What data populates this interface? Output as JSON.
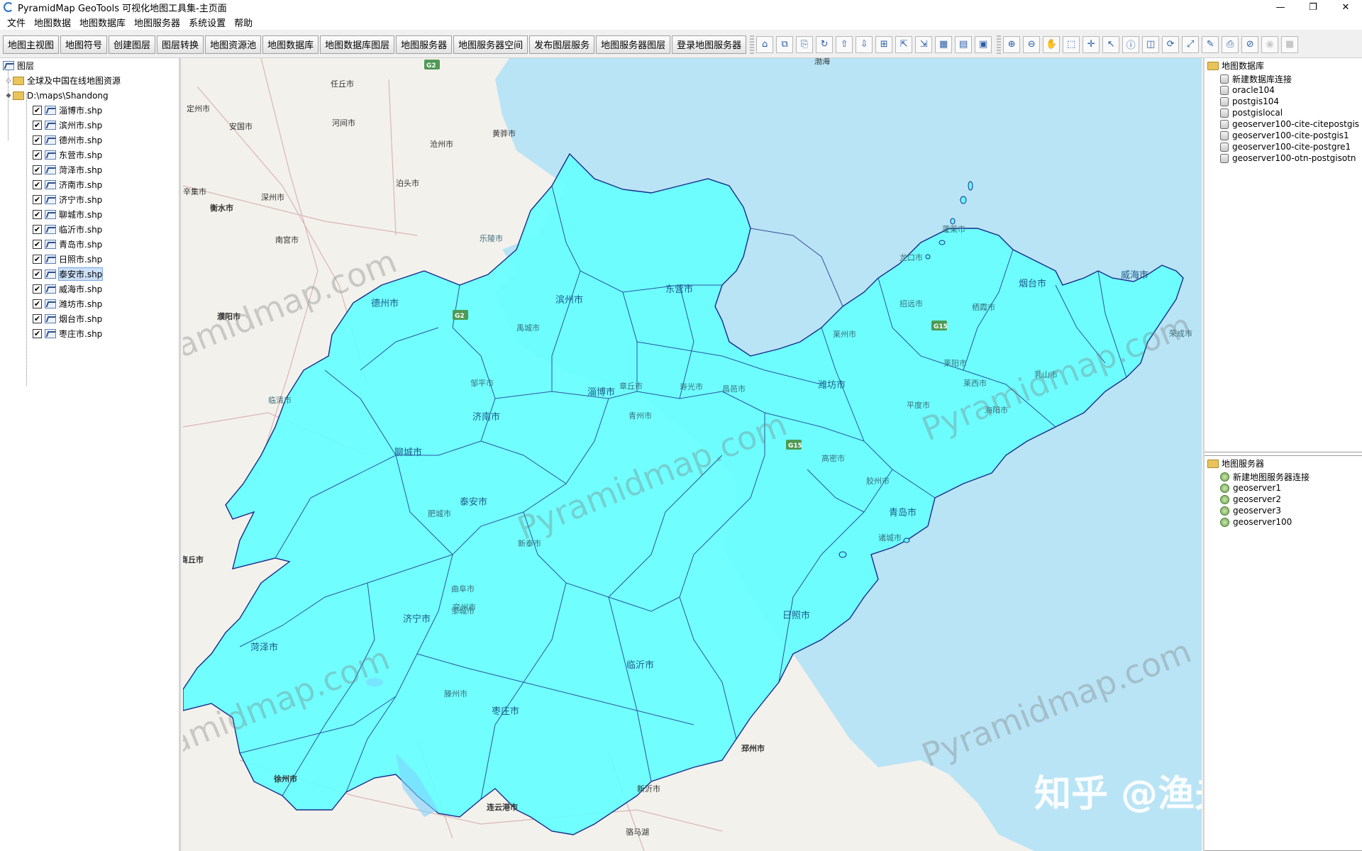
{
  "window": {
    "title": "PyramidMap GeoTools 可视化地图工具集-主页面",
    "controls": [
      "—",
      "❐",
      "✕"
    ]
  },
  "menu": [
    "文件",
    "地图数据",
    "地图数据库",
    "地图服务器",
    "系统设置",
    "帮助"
  ],
  "toolbar": {
    "text_buttons": [
      "地图主视图",
      "地图符号",
      "创建图层",
      "图层转换",
      "地图资源池",
      "地图数据库",
      "地图数据库图层",
      "地图服务器",
      "地图服务器空间",
      "发布图层服务",
      "地图服务器图层",
      "登录地图服务器"
    ],
    "icon_buttons": [
      {
        "name": "home-icon",
        "glyph": "⌂"
      },
      {
        "name": "copy-icon",
        "glyph": "⧉"
      },
      {
        "name": "paste-icon",
        "glyph": "⎘"
      },
      {
        "name": "refresh-layer-icon",
        "glyph": "↻"
      },
      {
        "name": "layer-up-icon",
        "glyph": "⇧"
      },
      {
        "name": "layer-down-icon",
        "glyph": "⇩"
      },
      {
        "name": "layer-merge-icon",
        "glyph": "⊞"
      },
      {
        "name": "layer-export-icon",
        "glyph": "⇱"
      },
      {
        "name": "layer-import-icon",
        "glyph": "⇲"
      },
      {
        "name": "layer-table-icon",
        "glyph": "▦"
      },
      {
        "name": "layer-style-icon",
        "glyph": "▤"
      },
      {
        "name": "layer-props-icon",
        "glyph": "▣"
      }
    ],
    "map_tools": [
      {
        "name": "zoom-in-icon",
        "glyph": "⊕"
      },
      {
        "name": "zoom-out-icon",
        "glyph": "⊖"
      },
      {
        "name": "pan-hand-icon",
        "glyph": "✋"
      },
      {
        "name": "select-rect-icon",
        "glyph": "⬚"
      },
      {
        "name": "center-icon",
        "glyph": "✛"
      },
      {
        "name": "pointer-icon",
        "glyph": "↖"
      },
      {
        "name": "info-icon",
        "glyph": "ⓘ"
      },
      {
        "name": "measure-icon",
        "glyph": "◫"
      },
      {
        "name": "reload-icon",
        "glyph": "⟳"
      },
      {
        "name": "full-extent-icon",
        "glyph": "⤢"
      },
      {
        "name": "edit-icon",
        "glyph": "✎"
      },
      {
        "name": "print-icon",
        "glyph": "⎙"
      },
      {
        "name": "cancel-icon",
        "glyph": "⊘"
      },
      {
        "name": "stop-icon",
        "glyph": "◉"
      },
      {
        "name": "disabled-icon",
        "glyph": "■"
      }
    ]
  },
  "layer_tree": {
    "root": "图层",
    "online": "全球及中国在线地图资源",
    "folder": "D:\\maps\\Shandong",
    "layers": [
      "淄博市.shp",
      "滨州市.shp",
      "德州市.shp",
      "东营市.shp",
      "菏泽市.shp",
      "济南市.shp",
      "济宁市.shp",
      "聊城市.shp",
      "临沂市.shp",
      "青岛市.shp",
      "日照市.shp",
      "泰安市.shp",
      "威海市.shp",
      "潍坊市.shp",
      "烟台市.shp",
      "枣庄市.shp"
    ],
    "selected_index": 11,
    "checked": "✔"
  },
  "map": {
    "colors": {
      "land": "#f3f1ec",
      "sea": "#b9e4f5",
      "province": "#66ffff",
      "boundary": "#1a2a8a"
    },
    "labels": {
      "city_major": [
        "德州市",
        "滨州市",
        "东营市",
        "聊城市",
        "济南市",
        "淄博市",
        "潍坊市",
        "烟台市",
        "威海市",
        "泰安市",
        "青岛市",
        "日照市",
        "临沂市",
        "济宁市",
        "菏泽市",
        "枣庄市"
      ],
      "neighbors": [
        "任丘市",
        "定州市",
        "安国市",
        "河间市",
        "黄骅市",
        "沧州市",
        "泊头市",
        "深州市",
        "辛集市",
        "衡水市",
        "南宫市",
        "濮阳市",
        "商丘市",
        "徐州市",
        "连云港市",
        "邳州市",
        "新沂市",
        "骆马湖",
        "渤海"
      ],
      "towns": [
        "乐陵市",
        "禹城市",
        "寿光市",
        "昌邑市",
        "高密市",
        "诸城市",
        "胶州市",
        "平度市",
        "莱西市",
        "莱阳市",
        "海阳市",
        "乳山市",
        "荣成市",
        "蓬莱市",
        "龙口市",
        "招远市",
        "栖霞市",
        "莱州市",
        "章丘市",
        "新泰市",
        "肥城市",
        "曲阜市",
        "邹城市",
        "滕州市",
        "兖州市",
        "青州市",
        "临清市",
        "邹平市"
      ],
      "badges": [
        "G2",
        "G2",
        "G15",
        "G15"
      ]
    }
  },
  "watermarks": [
    "Pyramidmap.com",
    "Pyramidmap.com",
    "Pyramidmap.com",
    "Pyramidmap.com",
    "Pyramidmap.com"
  ],
  "watermark_brand": "知乎 @渔夫之宝",
  "db_panel": {
    "title": "地图数据库",
    "items": [
      "新建数据库连接",
      "oracle104",
      "postgis104",
      "postgislocal",
      "geoserver100-cite-citepostgis",
      "geoserver100-cite-postgis1",
      "geoserver100-cite-postgre1",
      "geoserver100-otn-postgisotn"
    ]
  },
  "server_panel": {
    "title": "地图服务器",
    "items": [
      "新建地图服务器连接",
      "geoserver1",
      "geoserver2",
      "geoserver3",
      "geoserver100"
    ]
  }
}
